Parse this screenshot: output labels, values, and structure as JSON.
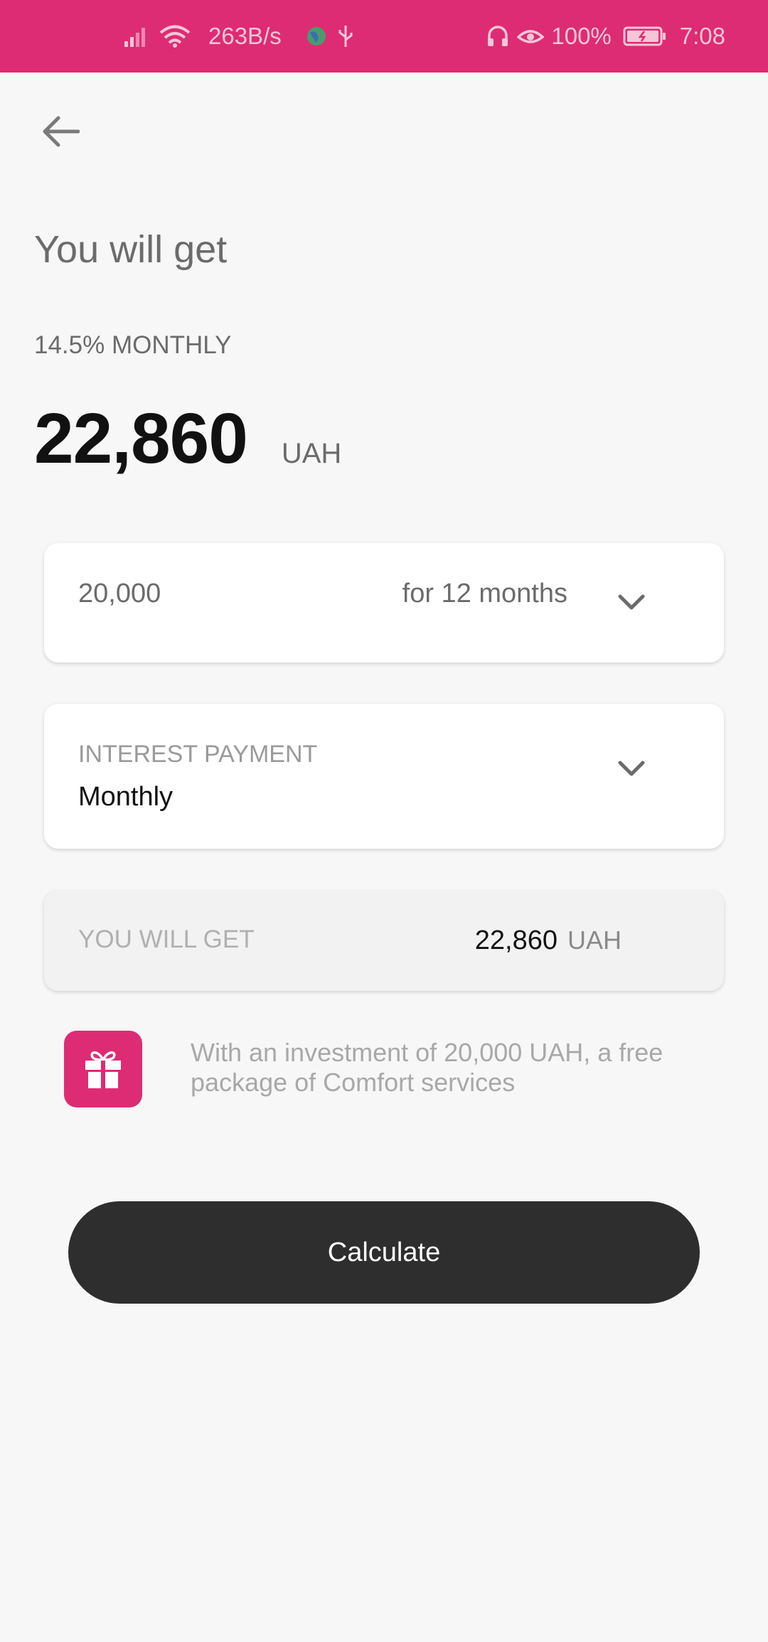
{
  "status_bar": {
    "net_speed": "263B/s",
    "battery": "100%",
    "time": "7:08"
  },
  "header": {
    "title": "You will get",
    "rate_label": "14.5% MONTHLY",
    "amount": "22,860",
    "currency": "UAH"
  },
  "deposit_card": {
    "amount": "20,000",
    "term": "for 12 months"
  },
  "interest_card": {
    "label": "INTEREST PAYMENT",
    "value": "Monthly"
  },
  "result_card": {
    "label": "YOU WILL GET",
    "amount": "22,860",
    "currency": "UAH"
  },
  "promo": {
    "text": "With an investment of 20,000 UAH, a free package of Comfort services"
  },
  "actions": {
    "calculate_label": "Calculate"
  },
  "colors": {
    "brand": "#dd2c73",
    "button": "#2e2e2e",
    "background": "#f7f7f7"
  }
}
